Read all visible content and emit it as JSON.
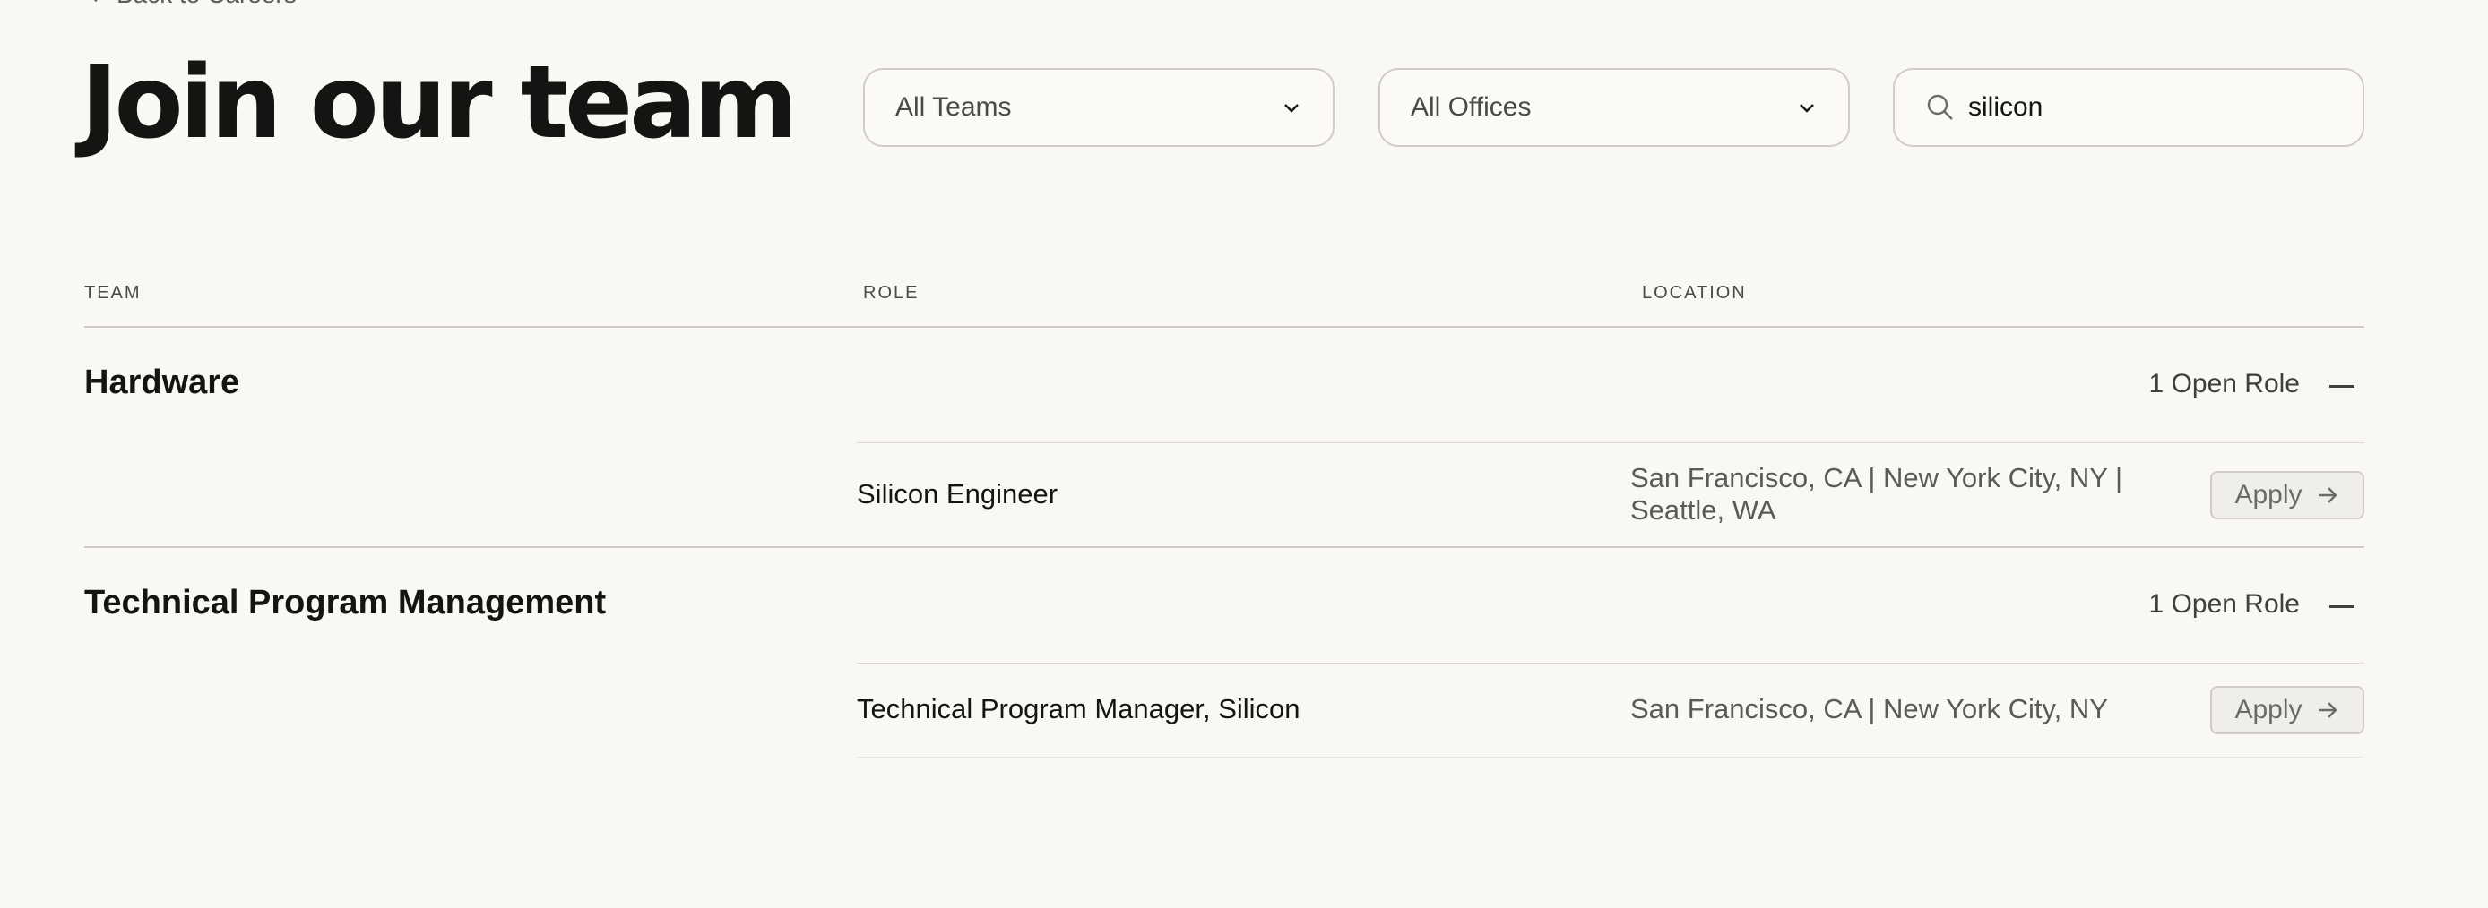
{
  "nav": {
    "back_label": "Back to Careers"
  },
  "page_title": "Join our team",
  "filters": {
    "teams_value": "All Teams",
    "offices_value": "All Offices",
    "search_value": "silicon"
  },
  "columns": {
    "team": "TEAM",
    "role": "ROLE",
    "location": "LOCATION"
  },
  "groups": [
    {
      "team": "Hardware",
      "open_count": "1 Open Role",
      "roles": [
        {
          "title": "Silicon Engineer",
          "location": "San Francisco, CA | New York City, NY | Seattle, WA",
          "apply_label": "Apply"
        }
      ]
    },
    {
      "team": "Technical Program Management",
      "open_count": "1 Open Role",
      "roles": [
        {
          "title": "Technical Program Manager, Silicon",
          "location": "San Francisco, CA | New York City, NY",
          "apply_label": "Apply"
        }
      ]
    }
  ],
  "colors": {
    "background": "#f9f8f4",
    "text": "#141413",
    "border": "#cfcdc6"
  },
  "icons": [
    "chevron-left-icon",
    "chevron-down-icon",
    "search-icon",
    "collapse-icon",
    "arrow-right-icon"
  ]
}
